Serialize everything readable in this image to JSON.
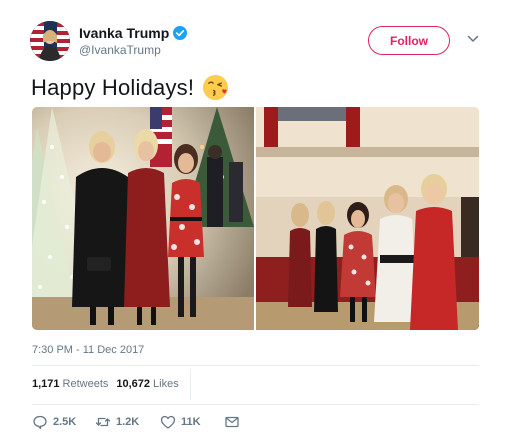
{
  "author": {
    "display_name": "Ivanka Trump",
    "handle": "@IvankaTrump",
    "verified": true,
    "avatar_icon": "avatar-photo"
  },
  "follow_button": {
    "label": "Follow",
    "color": "#e0245e"
  },
  "menu_icon": "chevron-down-icon",
  "tweet": {
    "text": "Happy Holidays!",
    "emoji": "face-blowing-kiss-emoji"
  },
  "media": [
    {
      "icon": "photo-christmas-tree-three-women"
    },
    {
      "icon": "photo-five-women-hallway"
    }
  ],
  "timestamp": "7:30 PM - 11 Dec 2017",
  "stats": {
    "retweets_count": "1,171",
    "retweets_label": "Retweets",
    "likes_count": "10,672",
    "likes_label": "Likes"
  },
  "actions": {
    "reply_count": "2.5K",
    "retweet_count": "1.2K",
    "like_count": "11K"
  },
  "colors": {
    "text_primary": "#14171a",
    "text_secondary": "#657786",
    "verified_blue": "#1da1f2",
    "divider": "#e6ecf0"
  }
}
